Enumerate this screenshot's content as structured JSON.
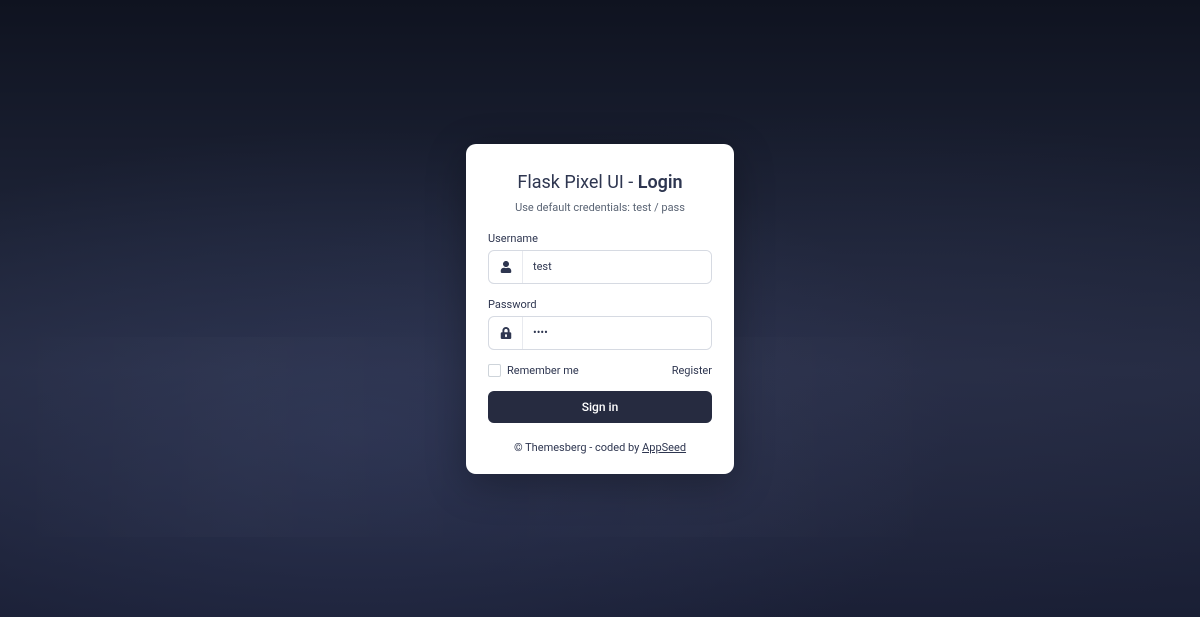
{
  "title": {
    "brand": "Flask Pixel UI",
    "separator": " - ",
    "page": "Login"
  },
  "subtitle": "Use default credentials: test / pass",
  "form": {
    "username": {
      "label": "Username",
      "value": "test"
    },
    "password": {
      "label": "Password",
      "value": "••••"
    },
    "remember": {
      "label": "Remember me"
    },
    "register_link": "Register",
    "submit_label": "Sign in"
  },
  "footer": {
    "prefix": "© Themesberg - coded by ",
    "link_text": "AppSeed"
  }
}
